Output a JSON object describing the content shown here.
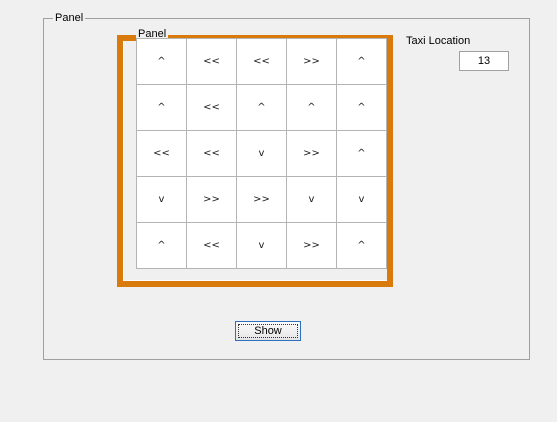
{
  "outer_panel": {
    "title": "Panel"
  },
  "inner_panel": {
    "title": "Panel"
  },
  "grid": {
    "rows": [
      [
        "^",
        "<<",
        "<<",
        ">>",
        "^"
      ],
      [
        "^",
        "<<",
        "^",
        "^",
        "^"
      ],
      [
        "<<",
        "<<",
        "v",
        ">>",
        "^"
      ],
      [
        "v",
        ">>",
        ">>",
        "v",
        "v"
      ],
      [
        "^",
        "<<",
        "v",
        ">>",
        "^"
      ]
    ]
  },
  "taxi_location": {
    "label": "Taxi Location",
    "value": "13"
  },
  "show_button": {
    "label": "Show"
  },
  "colors": {
    "frame_accent": "#d97b0c",
    "background": "#f0f0f0",
    "focus_border": "#2f6fc0"
  }
}
